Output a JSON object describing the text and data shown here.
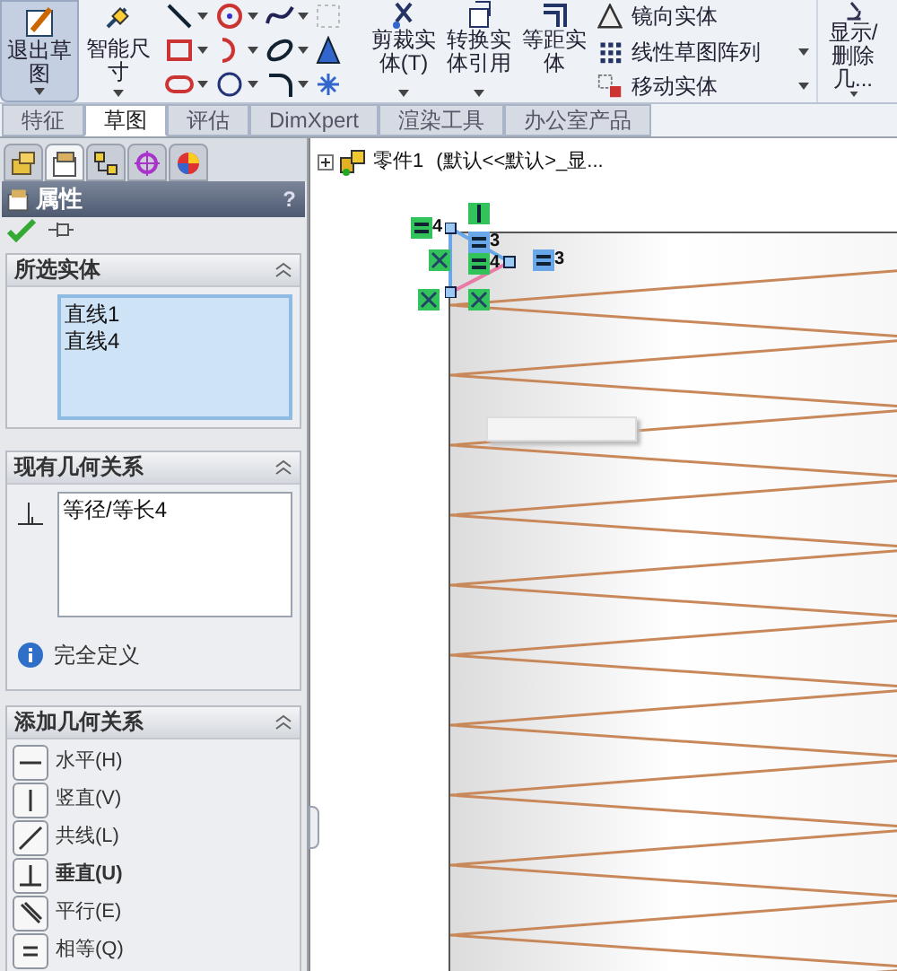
{
  "ribbon": {
    "big_buttons": [
      {
        "label": "退出草图",
        "selected": true
      },
      {
        "label": "智能尺寸",
        "selected": false
      }
    ],
    "tool_buttons": [
      {
        "label": "剪裁实体(T)"
      },
      {
        "label": "转换实体引用"
      },
      {
        "label": "等距实体"
      }
    ],
    "list_commands": [
      {
        "label": "镜向实体"
      },
      {
        "label": "线性草图阵列"
      },
      {
        "label": "移动实体"
      }
    ],
    "end_button": {
      "label": "显示/删除几..."
    }
  },
  "tabs": [
    {
      "label": "特征",
      "selected": false
    },
    {
      "label": "草图",
      "selected": true
    },
    {
      "label": "评估",
      "selected": false
    },
    {
      "label": "DimXpert",
      "selected": false
    },
    {
      "label": "渲染工具",
      "selected": false
    },
    {
      "label": "办公室产品",
      "selected": false
    }
  ],
  "panel": {
    "tabs": [
      {
        "kind": "feature",
        "selected": false
      },
      {
        "kind": "property",
        "selected": true
      },
      {
        "kind": "config",
        "selected": false
      },
      {
        "kind": "dim",
        "selected": false
      },
      {
        "kind": "display",
        "selected": false
      }
    ],
    "title": "属性",
    "help": "?",
    "selected_entities": {
      "title": "所选实体",
      "expanded": true,
      "items": [
        "直线1",
        "直线4"
      ]
    },
    "existing_relations": {
      "title": "现有几何关系",
      "expanded": true,
      "items": [
        "等径/等长4"
      ],
      "status": "完全定义"
    },
    "add_relations": {
      "title": "添加几何关系",
      "expanded": true,
      "items": [
        {
          "kind": "horizontal",
          "label": "水平(H)",
          "bold": false
        },
        {
          "kind": "vertical",
          "label": "竖直(V)",
          "bold": false
        },
        {
          "kind": "collinear",
          "label": "共线(L)",
          "bold": false
        },
        {
          "kind": "perpendicular",
          "label": "垂直(U)",
          "bold": true
        },
        {
          "kind": "parallel",
          "label": "平行(E)",
          "bold": false
        },
        {
          "kind": "equal",
          "label": "相等(Q)",
          "bold": false
        }
      ]
    }
  },
  "tree": {
    "name": "零件1",
    "config": "(默认<<默认>_显..."
  },
  "sketch": {
    "badges": [
      {
        "kind": "equal",
        "text": "4",
        "highlighted": false
      },
      {
        "kind": "vertical",
        "highlighted": false
      },
      {
        "kind": "equal",
        "text": "3",
        "highlighted": true
      },
      {
        "kind": "coincident",
        "highlighted": false
      },
      {
        "kind": "equal",
        "text": "4",
        "highlighted": false
      },
      {
        "kind": "equal",
        "text": "3",
        "highlighted": true
      },
      {
        "kind": "coincident",
        "highlighted": false
      },
      {
        "kind": "coincident",
        "highlighted": false
      }
    ]
  }
}
